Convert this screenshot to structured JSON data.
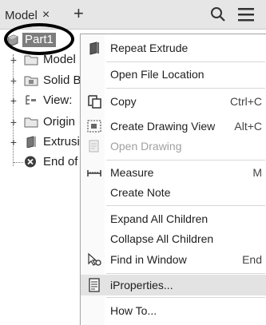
{
  "browser": {
    "tab_label": "Model",
    "tab_close": "×",
    "tab_add": "+",
    "tree": [
      {
        "label": "Part1",
        "icon": "part-icon"
      },
      {
        "label": "Model",
        "icon": "folder-icon",
        "expander": "+"
      },
      {
        "label": "Solid B",
        "icon": "solid-body-folder-icon",
        "expander": "+"
      },
      {
        "label": "View:",
        "icon": "view-icon",
        "expander": "+"
      },
      {
        "label": "Origin",
        "icon": "folder-icon",
        "expander": "+"
      },
      {
        "label": "Extrusi",
        "icon": "extrusion-icon",
        "expander": "+"
      },
      {
        "label": "End of",
        "icon": "end-of-part-icon"
      }
    ]
  },
  "menu": {
    "items": [
      {
        "label": "Repeat Extrude",
        "shortcut": "",
        "icon": "extrude-icon"
      },
      {
        "label": "Open File Location",
        "shortcut": ""
      },
      {
        "label": "Copy",
        "shortcut": "Ctrl+C",
        "icon": "copy-icon"
      },
      {
        "label": "Create Drawing View",
        "shortcut": "Alt+C",
        "icon": "drawing-view-icon"
      },
      {
        "label": "Open Drawing",
        "shortcut": "",
        "icon": "open-drawing-icon",
        "disabled": true
      },
      {
        "label": "Measure",
        "shortcut": "M",
        "icon": "measure-icon"
      },
      {
        "label": "Create Note",
        "shortcut": ""
      },
      {
        "label": "Expand All Children",
        "shortcut": ""
      },
      {
        "label": "Collapse All Children",
        "shortcut": ""
      },
      {
        "label": "Find in Window",
        "shortcut": "End",
        "icon": "find-in-window-icon"
      },
      {
        "label": "iProperties...",
        "shortcut": "",
        "icon": "iproperties-icon",
        "highlighted": true
      },
      {
        "label": "How To...",
        "shortcut": ""
      }
    ]
  },
  "colors": {
    "selection": "#7d7d7d",
    "highlight": "#e3e3e3",
    "disabled_text": "#a0a0a0"
  }
}
